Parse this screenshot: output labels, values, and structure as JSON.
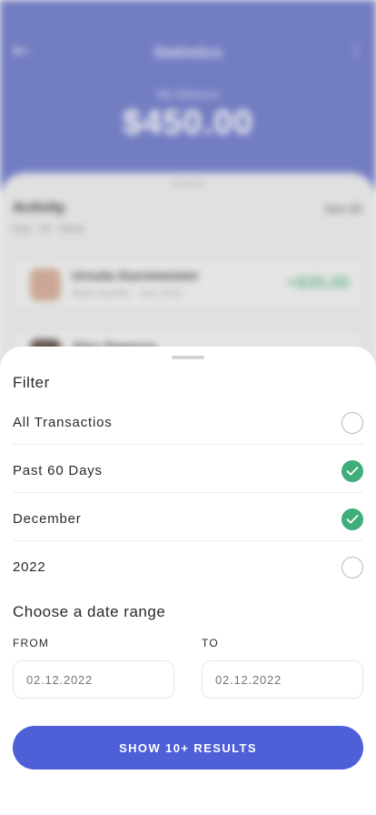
{
  "background": {
    "title": "Statistics",
    "balance_label": "My Balance",
    "balance": "$450.00",
    "activity": {
      "title": "Activity",
      "see_all": "See All",
      "subtitle": "Day · 30 · Week"
    },
    "transactions": [
      {
        "name": "Ursula Gurnmeister",
        "desc": "Bank transfer · Dec 2022",
        "amount": "+$35.00"
      },
      {
        "name": "Alex Dawson",
        "desc": "",
        "amount": ""
      }
    ]
  },
  "sheet": {
    "title": "Filter",
    "options": [
      {
        "label": "All Transactios",
        "checked": false
      },
      {
        "label": "Past 60 Days",
        "checked": true
      },
      {
        "label": "December",
        "checked": true
      },
      {
        "label": "2022",
        "checked": false
      }
    ],
    "date_range": {
      "title": "Choose a date range",
      "from_label": "FROM",
      "to_label": "TO",
      "from_placeholder": "02.12.2022",
      "to_placeholder": "02.12.2022"
    },
    "results_button": "SHOW 10+ RESULTS"
  },
  "colors": {
    "accent": "#4f5fd8",
    "check": "#3fae7a",
    "header": "#7b86cf"
  }
}
